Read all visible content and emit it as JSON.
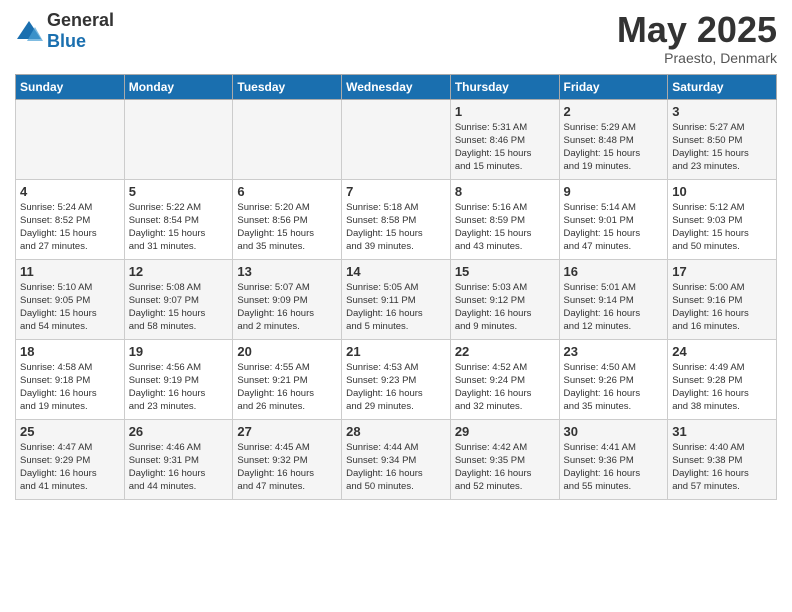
{
  "header": {
    "logo_general": "General",
    "logo_blue": "Blue",
    "month": "May 2025",
    "location": "Praesto, Denmark"
  },
  "weekdays": [
    "Sunday",
    "Monday",
    "Tuesday",
    "Wednesday",
    "Thursday",
    "Friday",
    "Saturday"
  ],
  "weeks": [
    [
      {
        "day": "",
        "detail": ""
      },
      {
        "day": "",
        "detail": ""
      },
      {
        "day": "",
        "detail": ""
      },
      {
        "day": "",
        "detail": ""
      },
      {
        "day": "1",
        "detail": "Sunrise: 5:31 AM\nSunset: 8:46 PM\nDaylight: 15 hours\nand 15 minutes."
      },
      {
        "day": "2",
        "detail": "Sunrise: 5:29 AM\nSunset: 8:48 PM\nDaylight: 15 hours\nand 19 minutes."
      },
      {
        "day": "3",
        "detail": "Sunrise: 5:27 AM\nSunset: 8:50 PM\nDaylight: 15 hours\nand 23 minutes."
      }
    ],
    [
      {
        "day": "4",
        "detail": "Sunrise: 5:24 AM\nSunset: 8:52 PM\nDaylight: 15 hours\nand 27 minutes."
      },
      {
        "day": "5",
        "detail": "Sunrise: 5:22 AM\nSunset: 8:54 PM\nDaylight: 15 hours\nand 31 minutes."
      },
      {
        "day": "6",
        "detail": "Sunrise: 5:20 AM\nSunset: 8:56 PM\nDaylight: 15 hours\nand 35 minutes."
      },
      {
        "day": "7",
        "detail": "Sunrise: 5:18 AM\nSunset: 8:58 PM\nDaylight: 15 hours\nand 39 minutes."
      },
      {
        "day": "8",
        "detail": "Sunrise: 5:16 AM\nSunset: 8:59 PM\nDaylight: 15 hours\nand 43 minutes."
      },
      {
        "day": "9",
        "detail": "Sunrise: 5:14 AM\nSunset: 9:01 PM\nDaylight: 15 hours\nand 47 minutes."
      },
      {
        "day": "10",
        "detail": "Sunrise: 5:12 AM\nSunset: 9:03 PM\nDaylight: 15 hours\nand 50 minutes."
      }
    ],
    [
      {
        "day": "11",
        "detail": "Sunrise: 5:10 AM\nSunset: 9:05 PM\nDaylight: 15 hours\nand 54 minutes."
      },
      {
        "day": "12",
        "detail": "Sunrise: 5:08 AM\nSunset: 9:07 PM\nDaylight: 15 hours\nand 58 minutes."
      },
      {
        "day": "13",
        "detail": "Sunrise: 5:07 AM\nSunset: 9:09 PM\nDaylight: 16 hours\nand 2 minutes."
      },
      {
        "day": "14",
        "detail": "Sunrise: 5:05 AM\nSunset: 9:11 PM\nDaylight: 16 hours\nand 5 minutes."
      },
      {
        "day": "15",
        "detail": "Sunrise: 5:03 AM\nSunset: 9:12 PM\nDaylight: 16 hours\nand 9 minutes."
      },
      {
        "day": "16",
        "detail": "Sunrise: 5:01 AM\nSunset: 9:14 PM\nDaylight: 16 hours\nand 12 minutes."
      },
      {
        "day": "17",
        "detail": "Sunrise: 5:00 AM\nSunset: 9:16 PM\nDaylight: 16 hours\nand 16 minutes."
      }
    ],
    [
      {
        "day": "18",
        "detail": "Sunrise: 4:58 AM\nSunset: 9:18 PM\nDaylight: 16 hours\nand 19 minutes."
      },
      {
        "day": "19",
        "detail": "Sunrise: 4:56 AM\nSunset: 9:19 PM\nDaylight: 16 hours\nand 23 minutes."
      },
      {
        "day": "20",
        "detail": "Sunrise: 4:55 AM\nSunset: 9:21 PM\nDaylight: 16 hours\nand 26 minutes."
      },
      {
        "day": "21",
        "detail": "Sunrise: 4:53 AM\nSunset: 9:23 PM\nDaylight: 16 hours\nand 29 minutes."
      },
      {
        "day": "22",
        "detail": "Sunrise: 4:52 AM\nSunset: 9:24 PM\nDaylight: 16 hours\nand 32 minutes."
      },
      {
        "day": "23",
        "detail": "Sunrise: 4:50 AM\nSunset: 9:26 PM\nDaylight: 16 hours\nand 35 minutes."
      },
      {
        "day": "24",
        "detail": "Sunrise: 4:49 AM\nSunset: 9:28 PM\nDaylight: 16 hours\nand 38 minutes."
      }
    ],
    [
      {
        "day": "25",
        "detail": "Sunrise: 4:47 AM\nSunset: 9:29 PM\nDaylight: 16 hours\nand 41 minutes."
      },
      {
        "day": "26",
        "detail": "Sunrise: 4:46 AM\nSunset: 9:31 PM\nDaylight: 16 hours\nand 44 minutes."
      },
      {
        "day": "27",
        "detail": "Sunrise: 4:45 AM\nSunset: 9:32 PM\nDaylight: 16 hours\nand 47 minutes."
      },
      {
        "day": "28",
        "detail": "Sunrise: 4:44 AM\nSunset: 9:34 PM\nDaylight: 16 hours\nand 50 minutes."
      },
      {
        "day": "29",
        "detail": "Sunrise: 4:42 AM\nSunset: 9:35 PM\nDaylight: 16 hours\nand 52 minutes."
      },
      {
        "day": "30",
        "detail": "Sunrise: 4:41 AM\nSunset: 9:36 PM\nDaylight: 16 hours\nand 55 minutes."
      },
      {
        "day": "31",
        "detail": "Sunrise: 4:40 AM\nSunset: 9:38 PM\nDaylight: 16 hours\nand 57 minutes."
      }
    ]
  ]
}
